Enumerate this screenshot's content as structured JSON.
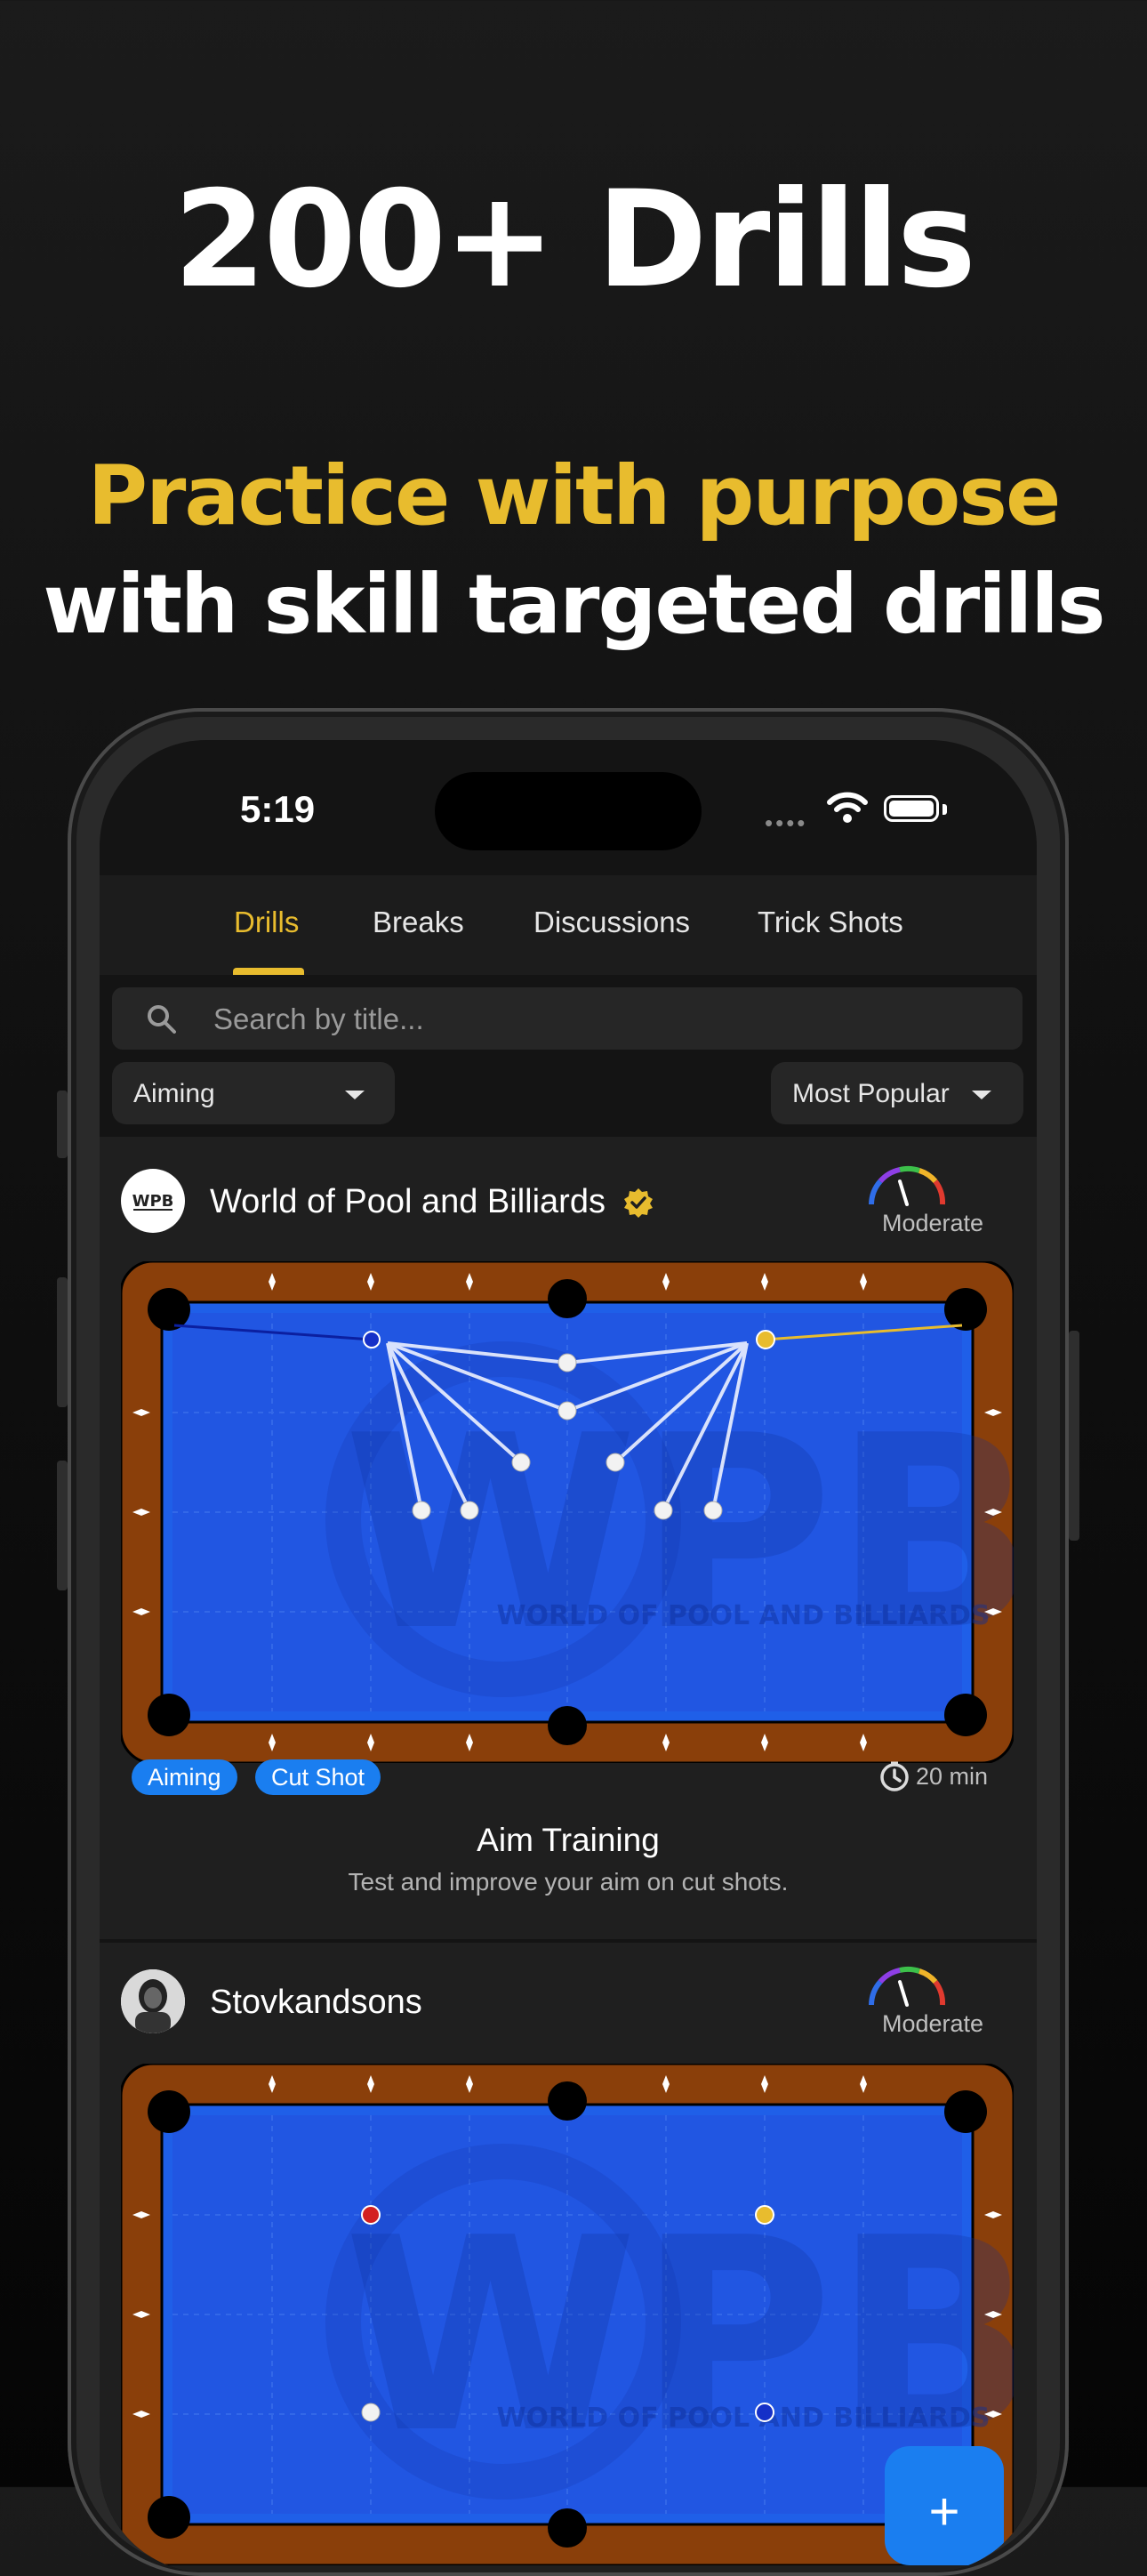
{
  "marketing": {
    "headline": "200+ Drills",
    "subheadline_line1": "Practice with purpose",
    "subheadline_line2": "with skill targeted drills",
    "accent_color": "#e8bc2e"
  },
  "status_bar": {
    "time": "5:19"
  },
  "tabs": [
    {
      "label": "Drills",
      "active": true
    },
    {
      "label": "Breaks",
      "active": false
    },
    {
      "label": "Discussions",
      "active": false
    },
    {
      "label": "Trick Shots",
      "active": false
    }
  ],
  "search": {
    "placeholder": "Search by title..."
  },
  "filters": {
    "category": "Aiming",
    "sort": "Most Popular"
  },
  "drills": [
    {
      "author": "World of Pool and Billiards",
      "verified": true,
      "difficulty": "Moderate",
      "tags": [
        "Aiming",
        "Cut Shot"
      ],
      "duration": "20 min",
      "title": "Aim Training",
      "description": "Test and improve your aim on cut shots.",
      "watermark": "WORLD OF POOL AND BILLIARDS"
    },
    {
      "author": "Stovkandsons",
      "verified": false,
      "difficulty": "Moderate",
      "watermark": "WORLD OF POOL AND BILLIARDS"
    }
  ],
  "fab": {
    "label": "+"
  },
  "colors": {
    "felt": "#1f5fe8",
    "rail": "#8a3f0a",
    "tag": "#1a7ef0",
    "tab_active": "#e8bc2e"
  }
}
